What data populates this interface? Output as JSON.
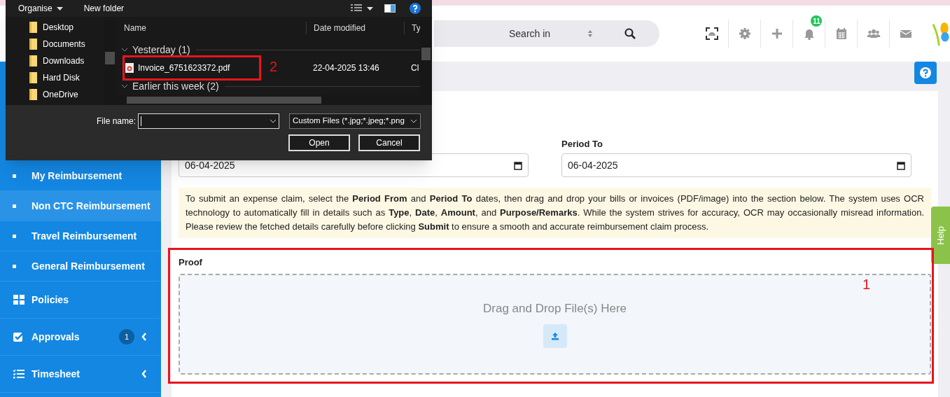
{
  "dialog": {
    "toolbar": {
      "organise": "Organise",
      "new_folder": "New folder"
    },
    "nav_items": [
      {
        "label": "Desktop"
      },
      {
        "label": "Documents"
      },
      {
        "label": "Downloads"
      },
      {
        "label": "Hard Disk"
      },
      {
        "label": "OneDrive"
      }
    ],
    "columns": [
      "Name",
      "Date modified",
      "Ty"
    ],
    "groups": [
      {
        "label": "Yesterday (1)",
        "expanded": true,
        "files": [
          {
            "name": "Invoice_6751623372.pdf",
            "date": "22-04-2025 13:46",
            "type": "Cl"
          }
        ]
      },
      {
        "label": "Earlier this week (2)",
        "expanded": true
      }
    ],
    "file_name_label": "File name:",
    "filter": "Custom Files (*.jpg;*.jpeg;*.png",
    "buttons": [
      "Open",
      "Cancel"
    ]
  },
  "header": {
    "search_scope": "Search in",
    "notification_count": "11"
  },
  "sidebar": {
    "items": [
      {
        "kind": "sub",
        "label": "My Reimbursement",
        "selected": false
      },
      {
        "kind": "sub",
        "label": "Non CTC Reimbursement",
        "selected": true
      },
      {
        "kind": "sub",
        "label": "Travel Reimbursement",
        "selected": false
      },
      {
        "kind": "sub",
        "label": "General Reimbursement",
        "selected": false
      },
      {
        "kind": "main",
        "label": "Policies",
        "selected": false
      },
      {
        "kind": "main",
        "label": "Approvals",
        "badge": "1",
        "chevron": true,
        "selected": false
      },
      {
        "kind": "main",
        "label": "Timesheet",
        "chevron": true,
        "selected": false
      }
    ]
  },
  "form": {
    "period_from": {
      "value": "06-04-2025"
    },
    "period_to": {
      "label": "Period To",
      "value": "06-04-2025"
    },
    "info": "To submit an expense claim, select the **Period From** and **Period To** dates, then drag and drop your bills or invoices (PDF/image) into the section below. The system uses OCR technology to automatically fill in details such as **Type**, **Date**, **Amount**, and **Purpose/Remarks**. While the system strives for accuracy, OCR may occasionally misread information. Please review the fetched details carefully before clicking **Submit** to ensure a smooth and accurate reimbursement claim process.",
    "proof_label": "Proof",
    "dropzone_text": "Drag and Drop File(s) Here"
  },
  "help_tab": "Help",
  "annotations": [
    {
      "label": "2"
    },
    {
      "label": "1"
    }
  ]
}
